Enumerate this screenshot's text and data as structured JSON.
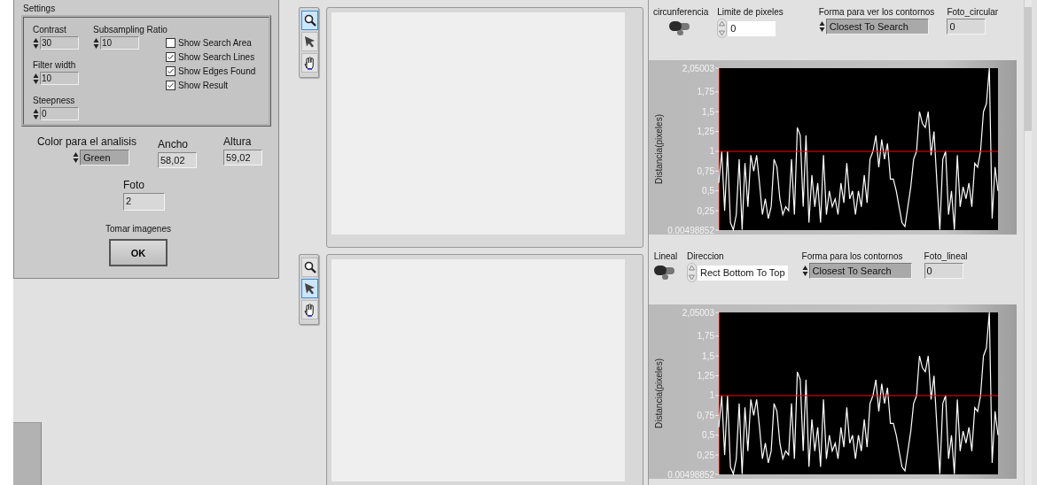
{
  "settings": {
    "title": "Settings",
    "numerics": [
      {
        "label": "Contrast",
        "value": "30"
      },
      {
        "label": "Subsampling Ratio",
        "value": "10"
      },
      {
        "label": "Filter width",
        "value": "10"
      },
      {
        "label": "Steepness",
        "value": "0"
      }
    ],
    "checkboxes": [
      {
        "label": "Show Search Area",
        "checked": false
      },
      {
        "label": "Show Search Lines",
        "checked": true
      },
      {
        "label": "Show Edges Found",
        "checked": true
      },
      {
        "label": "Show Result",
        "checked": true
      }
    ]
  },
  "color_analysis": {
    "label": "Color para el analisis",
    "value": "Green"
  },
  "ancho": {
    "label": "Ancho",
    "value": "58,02"
  },
  "altura": {
    "label": "Altura",
    "value": "59,02"
  },
  "foto": {
    "label": "Foto",
    "value": "2"
  },
  "capture": {
    "label": "Tomar imagenes",
    "button": "OK"
  },
  "sections": [
    {
      "tools": [
        {
          "kind": "zoom",
          "selected": true
        },
        {
          "kind": "pointer",
          "selected": false
        },
        {
          "kind": "hand",
          "selected": false
        }
      ],
      "toggle": {
        "label": "circunferencia",
        "on": false
      },
      "field": {
        "label": "Limite de pixeles",
        "value": "0"
      },
      "ring": {
        "label": "Forma para ver los contornos",
        "value": "Closest To Search"
      },
      "indicator": {
        "label": "Foto_circular",
        "value": "0"
      },
      "chart_data": {
        "type": "line",
        "ylabel": "Distancia(pixeles)",
        "ylim": [
          0.00498852,
          2.05003
        ],
        "yticks": [
          {
            "value": 2.05003,
            "label": "2,05003"
          },
          {
            "value": 1.75,
            "label": "1,75"
          },
          {
            "value": 1.5,
            "label": "1,5"
          },
          {
            "value": 1.25,
            "label": "1,25"
          },
          {
            "value": 1,
            "label": "1"
          },
          {
            "value": 0.75,
            "label": "0,75"
          },
          {
            "value": 0.5,
            "label": "0,5"
          },
          {
            "value": 0.25,
            "label": "0,25"
          },
          {
            "value": 0.00498852,
            "label": "0.00498852"
          }
        ],
        "series": [
          {
            "color": "#ffffff",
            "values": [
              0.6,
              1.0,
              0.25,
              1.0,
              0.1,
              0.01,
              0.2,
              0.9,
              0.01,
              0.85,
              0.3,
              0.95,
              0.75,
              0.95,
              0.6,
              0.2,
              0.4,
              0.15,
              0.3,
              0.9,
              0.8,
              0.4,
              0.2,
              0.3,
              0.25,
              0.9,
              0.2,
              1.3,
              1.2,
              0.3,
              1.2,
              0.1,
              0.7,
              0.3,
              0.6,
              0.1,
              0.95,
              0.2,
              0.5,
              0.3,
              0.4,
              0.2,
              0.6,
              0.35,
              0.85,
              0.4,
              0.5,
              0.2,
              0.5,
              0.3,
              0.7,
              0.35,
              0.9,
              1.0,
              1.2,
              0.8,
              1.15,
              0.9,
              1.1,
              0.65,
              0.65,
              0.5,
              0.3,
              0.1,
              0.05,
              0.3,
              0.55,
              0.9,
              1.0,
              1.5,
              1.35,
              1.3,
              1.5,
              0.95,
              1.25,
              0.6,
              0.01,
              0.9,
              1.0,
              0.2,
              0.5,
              0.01,
              0.95,
              0.3,
              0.55,
              0.4,
              0.6,
              0.3,
              0.85,
              0.8,
              1.0,
              1.5,
              1.6,
              2.05,
              0.15,
              0.8,
              0.5
            ]
          },
          {
            "color": "#ff0000",
            "values": [
              1,
              1,
              1,
              1,
              1,
              1,
              1,
              1,
              1,
              1,
              1,
              1,
              1,
              1,
              1,
              1,
              1,
              1,
              1,
              1,
              1,
              1,
              1,
              1,
              1,
              1,
              1,
              1,
              1,
              1,
              1,
              1,
              1,
              1,
              1,
              1,
              1,
              1,
              1,
              1,
              1,
              1,
              1,
              1,
              1,
              1,
              1,
              1,
              1,
              1,
              1,
              1,
              1,
              1,
              1,
              1,
              1,
              1,
              1,
              1,
              1,
              1,
              1,
              1,
              1,
              1,
              1,
              1,
              1,
              1,
              1,
              1,
              1,
              1,
              1,
              1,
              1,
              1,
              1,
              1,
              1,
              1,
              1,
              1,
              1,
              1,
              1,
              1,
              1,
              1,
              1,
              1,
              1,
              1,
              1,
              1,
              1
            ]
          }
        ]
      }
    },
    {
      "tools": [
        {
          "kind": "zoom",
          "selected": false
        },
        {
          "kind": "pointer",
          "selected": true
        },
        {
          "kind": "hand",
          "selected": false
        }
      ],
      "toggle": {
        "label": "Lineal",
        "on": false
      },
      "field": {
        "label": "Direccion",
        "value": "Rect Bottom To Top"
      },
      "ring": {
        "label": "Forma para los contornos",
        "value": "Closest To Search"
      },
      "indicator": {
        "label": "Foto_lineal",
        "value": "0"
      },
      "chart_data": {
        "type": "line",
        "ylabel": "Distancia(pixeles)",
        "ylim": [
          0.00498852,
          2.05003
        ],
        "yticks": [
          {
            "value": 2.05003,
            "label": "2,05003"
          },
          {
            "value": 1.75,
            "label": "1,75"
          },
          {
            "value": 1.5,
            "label": "1,5"
          },
          {
            "value": 1.25,
            "label": "1,25"
          },
          {
            "value": 1,
            "label": "1"
          },
          {
            "value": 0.75,
            "label": "0,75"
          },
          {
            "value": 0.5,
            "label": "0,5"
          },
          {
            "value": 0.25,
            "label": "0,25"
          },
          {
            "value": 0.00498852,
            "label": "0.00498852"
          }
        ],
        "series": [
          {
            "color": "#ffffff",
            "values": [
              0.6,
              1.0,
              0.25,
              1.0,
              0.1,
              0.01,
              0.2,
              0.9,
              0.01,
              0.85,
              0.3,
              0.95,
              0.75,
              0.95,
              0.6,
              0.2,
              0.4,
              0.15,
              0.3,
              0.9,
              0.8,
              0.4,
              0.2,
              0.3,
              0.25,
              0.9,
              0.2,
              1.3,
              1.2,
              0.3,
              1.2,
              0.1,
              0.7,
              0.3,
              0.6,
              0.1,
              0.95,
              0.2,
              0.5,
              0.3,
              0.4,
              0.2,
              0.6,
              0.35,
              0.85,
              0.4,
              0.5,
              0.2,
              0.5,
              0.3,
              0.7,
              0.35,
              0.9,
              1.0,
              1.2,
              0.8,
              1.15,
              0.9,
              1.1,
              0.65,
              0.65,
              0.5,
              0.3,
              0.1,
              0.05,
              0.3,
              0.55,
              0.9,
              1.0,
              1.5,
              1.35,
              1.3,
              1.5,
              0.95,
              1.25,
              0.6,
              0.01,
              0.9,
              1.0,
              0.2,
              0.5,
              0.01,
              0.95,
              0.3,
              0.55,
              0.4,
              0.6,
              0.3,
              0.85,
              0.8,
              1.0,
              1.5,
              1.6,
              2.05,
              0.15,
              0.8,
              0.5
            ]
          },
          {
            "color": "#ff0000",
            "values": [
              1,
              1,
              1,
              1,
              1,
              1,
              1,
              1,
              1,
              1,
              1,
              1,
              1,
              1,
              1,
              1,
              1,
              1,
              1,
              1,
              1,
              1,
              1,
              1,
              1,
              1,
              1,
              1,
              1,
              1,
              1,
              1,
              1,
              1,
              1,
              1,
              1,
              1,
              1,
              1,
              1,
              1,
              1,
              1,
              1,
              1,
              1,
              1,
              1,
              1,
              1,
              1,
              1,
              1,
              1,
              1,
              1,
              1,
              1,
              1,
              1,
              1,
              1,
              1,
              1,
              1,
              1,
              1,
              1,
              1,
              1,
              1,
              1,
              1,
              1,
              1,
              1,
              1,
              1,
              1,
              1,
              1,
              1,
              1,
              1,
              1,
              1,
              1,
              1,
              1,
              1,
              1,
              1,
              1,
              1,
              1,
              1
            ]
          }
        ]
      }
    }
  ]
}
